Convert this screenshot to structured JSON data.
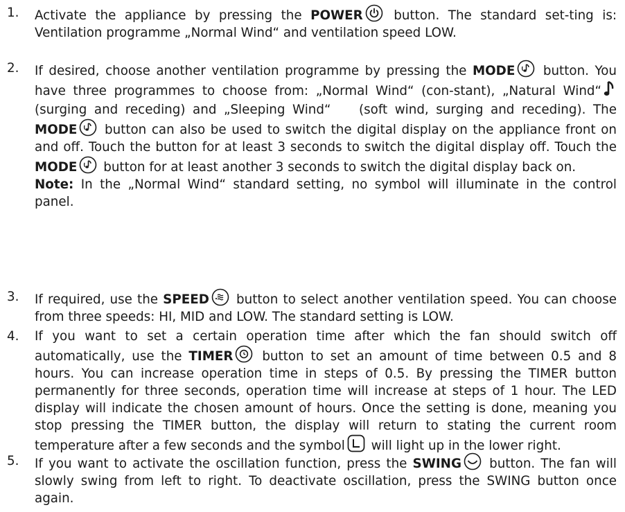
{
  "steps": [
    {
      "num": "1.",
      "t1": "Activate the appliance by pressing the ",
      "kw1": "POWER",
      "t2": " button. The standard set-ting is: Ventilation programme „Normal Wind“ and ventilation speed LOW."
    },
    {
      "num": "2.",
      "t1": "If desired, choose another ventilation programme by pressing the ",
      "kw1": "MODE",
      "t2": " button. You have three programmes to choose from: „Normal Wind“ (con-stant), „Natural Wind“",
      "t3": " (surging and receding) and „Sleeping Wind“",
      "t4": " (soft wind, surging and receding). The ",
      "kw2": "MODE",
      "t5": " button can also be used to switch the digital display on the appliance front on and off. Touch the button for at least 3 seconds to switch the digital display off. Touch the ",
      "kw3": "MODE",
      "t6": " button for at least another 3 seconds to switch the digital display back on.",
      "note_label": "Note:",
      "note_text": " In the „Normal Wind“ standard setting, no symbol will illuminate in the control panel."
    },
    {
      "num": "3.",
      "t1": "If required, use the ",
      "kw1": "SPEED",
      "t2": " button to select another ventilation speed. You can choose from three speeds: HI, MID and LOW. The standard setting is LOW."
    },
    {
      "num": "4.",
      "t1": "If you want to set a certain operation time after which the fan should switch off automatically, use the ",
      "kw1": "TIMER",
      "t2": " button to set an amount of time between 0.5 and 8 hours. You can increase operation time in steps of 0.5. By pressing the TIMER button permanently for three seconds, operation time will increase at steps of 1 hour. The LED display will indicate the chosen amount of hours. Once the setting is done, meaning you stop pressing the TIMER button, the display will return to stating the current room temperature after a few seconds and the symbol",
      "t3": " will light up in the lower right."
    },
    {
      "num": "5.",
      "t1": "If you want to activate the oscillation function, press the ",
      "kw1": "SWING",
      "t2": " button. The fan will slowly swing from left to right. To deactivate oscillation, press the SWING button once again."
    }
  ],
  "icons": {
    "power": "power-icon",
    "mode": "mode-icon",
    "natural_wind": "music-note-icon",
    "sleeping_wind": "crescent-moon-icon",
    "speed": "speed-icon",
    "timer": "timer-icon",
    "timer_symbol": "timer-display-symbol-icon",
    "swing": "swing-icon"
  }
}
